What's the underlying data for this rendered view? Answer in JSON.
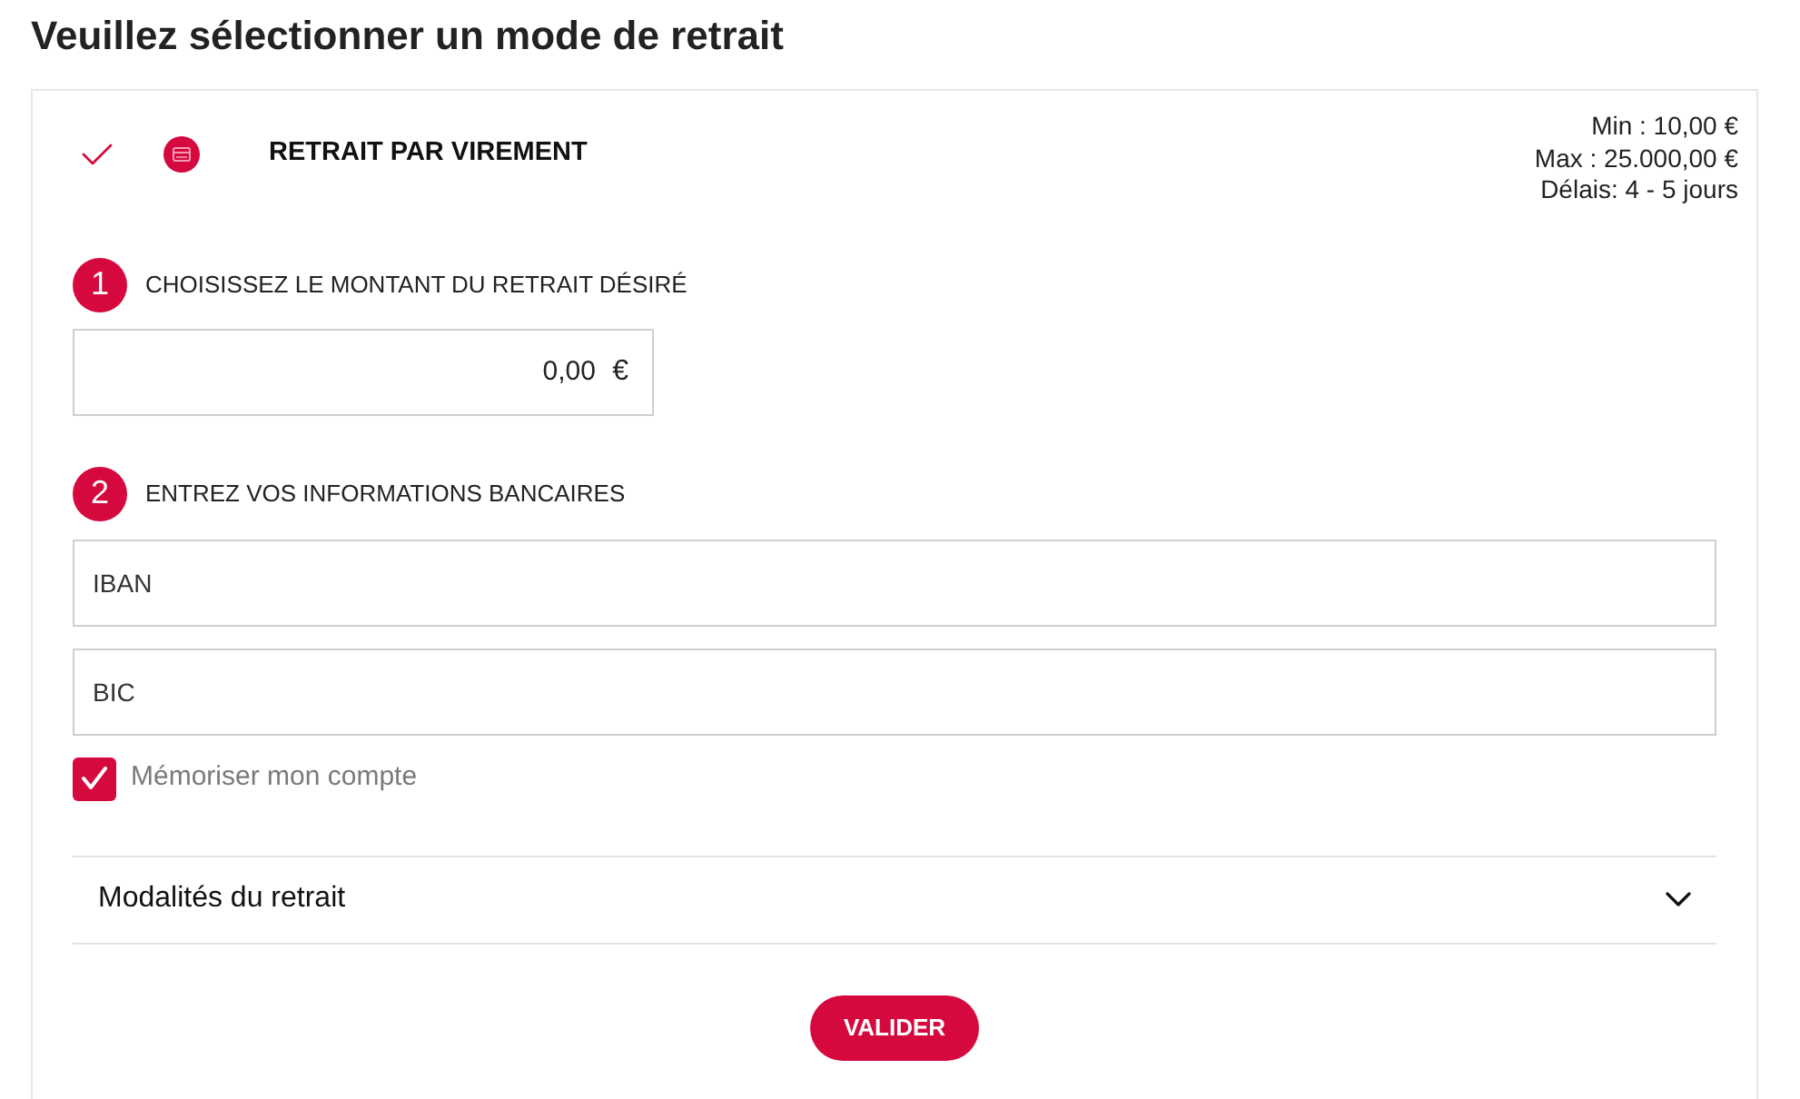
{
  "page": {
    "title": "Veuillez sélectionner un mode de retrait"
  },
  "method": {
    "selected": true,
    "title": "RETRAIT PAR VIREMENT",
    "limits": [
      "Min : 10,00 €",
      "Max : 25.000,00 €",
      "Délais: 4 - 5 jours"
    ]
  },
  "steps": [
    {
      "number": "1",
      "label": "CHOISISSEZ LE MONTANT DU RETRAIT DÉSIRÉ"
    },
    {
      "number": "2",
      "label": "ENTREZ VOS INFORMATIONS BANCAIRES"
    }
  ],
  "amount_field": {
    "value": "0,00",
    "currency": "€"
  },
  "bank_fields": [
    {
      "placeholder": "IBAN"
    },
    {
      "placeholder": "BIC"
    }
  ],
  "remember_account": {
    "label": "Mémoriser mon compte",
    "checked": true
  },
  "accordion": {
    "label": "Modalités du retrait",
    "expanded": false
  },
  "submit_button": {
    "label": "VALIDER"
  }
}
